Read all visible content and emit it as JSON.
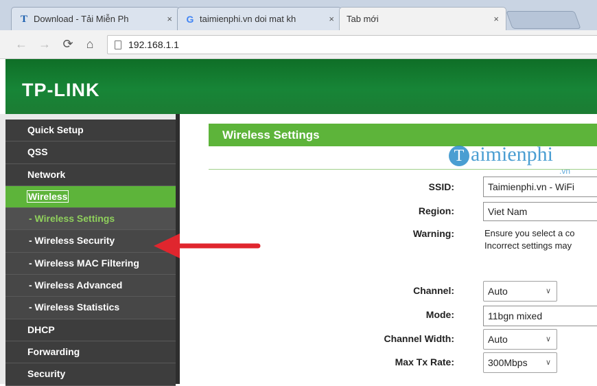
{
  "browser": {
    "tabs": [
      {
        "title": "Download - Tải Miễn Ph",
        "favicon": "tp-favicon-icon"
      },
      {
        "title": "taimienphi.vn doi mat kh",
        "favicon": "google-favicon-icon"
      },
      {
        "title": "Tab mới",
        "favicon": ""
      }
    ],
    "close_glyph": "×",
    "address": "192.168.1.1"
  },
  "header": {
    "logo": "TP-LINK"
  },
  "sidebar": {
    "items": [
      {
        "label": "Quick Setup"
      },
      {
        "label": "QSS"
      },
      {
        "label": "Network"
      },
      {
        "label": "Wireless"
      },
      {
        "label": "- Wireless Settings"
      },
      {
        "label": "- Wireless Security"
      },
      {
        "label": "- Wireless MAC Filtering"
      },
      {
        "label": "- Wireless Advanced"
      },
      {
        "label": "- Wireless Statistics"
      },
      {
        "label": "DHCP"
      },
      {
        "label": "Forwarding"
      },
      {
        "label": "Security"
      }
    ]
  },
  "main": {
    "title": "Wireless Settings",
    "watermark": {
      "brand": "aimienphi",
      "brand_letter": "T",
      "suffix": ".vn"
    },
    "fields": {
      "ssid": {
        "label": "SSID:",
        "value": "Taimienphi.vn - WiFi"
      },
      "region": {
        "label": "Region:",
        "value": "Viet Nam"
      },
      "warning": {
        "label": "Warning:",
        "line1": "Ensure you select a co",
        "line2": "Incorrect settings may"
      },
      "channel": {
        "label": "Channel:",
        "value": "Auto"
      },
      "mode": {
        "label": "Mode:",
        "value": "11bgn mixed"
      },
      "channel_width": {
        "label": "Channel Width:",
        "value": "Auto"
      },
      "max_tx_rate": {
        "label": "Max Tx Rate:",
        "value": "300Mbps"
      }
    }
  },
  "colors": {
    "accent_green": "#5db43a",
    "banner_green": "#178537",
    "arrow_red": "#e0262e"
  }
}
